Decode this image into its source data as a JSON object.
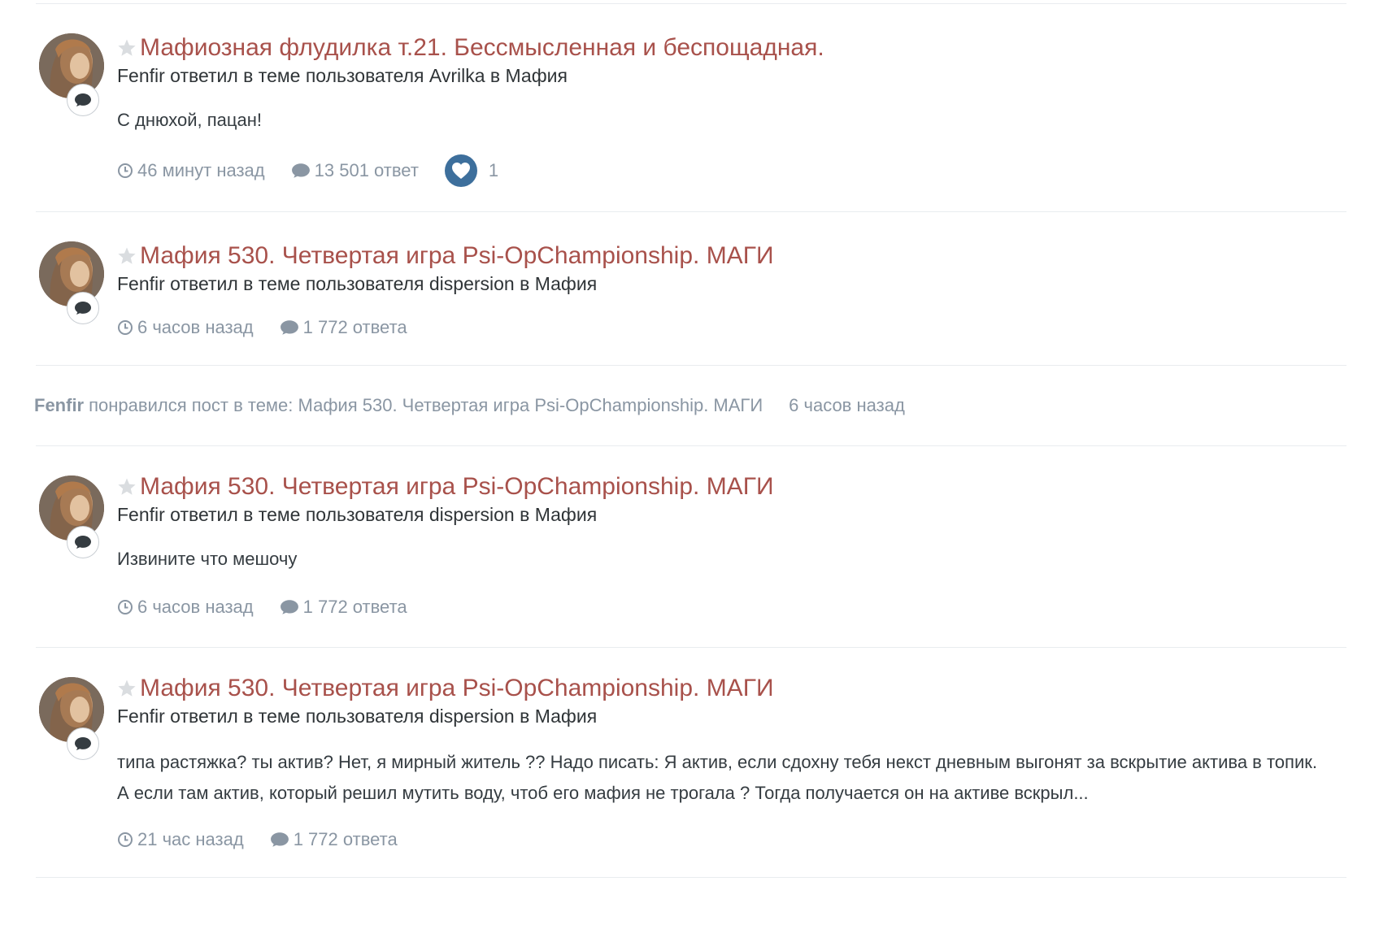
{
  "items": [
    {
      "title": "Мафиозная флудилка т.21. Бессмысленная и беспощадная.",
      "subtitle": "Fenfir ответил в теме пользователя Avrilka в Мафия",
      "snippet": "С днюхой, пацан!",
      "time": "46 минут назад",
      "replies": "13 501 ответ",
      "reaction_count": "1"
    },
    {
      "title": "Мафия 530. Четвертая игра Psi-OpChampionship. МАГИ",
      "subtitle": "Fenfir ответил в теме пользователя dispersion в Мафия",
      "time": "6 часов назад",
      "replies": "1 772 ответа"
    },
    {
      "title": "Мафия 530. Четвертая игра Psi-OpChampionship. МАГИ",
      "subtitle": "Fenfir ответил в теме пользователя dispersion в Мафия",
      "snippet": "Извините что мешочу",
      "time": "6 часов назад",
      "replies": "1 772 ответа"
    },
    {
      "title": "Мафия 530. Четвертая игра Psi-OpChampionship. МАГИ",
      "subtitle": "Fenfir ответил в теме пользователя dispersion в Мафия",
      "snippet": "типа растяжка? ты актив? Нет, я мирный житель ?? Надо писать: Я актив, если сдохну тебя некст дневным выгонят за вскрытие актива в топик. А если там актив, который решил мутить воду, чтоб его мафия не трогала ? Тогда получается он на активе вскрыл...",
      "time": "21 час назад",
      "replies": "1 772 ответа"
    }
  ],
  "like_event": {
    "user": "Fenfir",
    "text": "понравился пост в теме: Мафия 530. Четвертая игра Psi-OpChampionship. МАГИ",
    "time": "6 часов назад"
  },
  "icons": {
    "star": "star-icon",
    "comment_badge": "comment-icon",
    "clock": "clock-icon",
    "replies": "comment-icon",
    "reaction": "heart-icon"
  },
  "colors": {
    "title": "#a8514b",
    "meta": "#8a96a3",
    "reaction_bg": "#3d6f9c"
  }
}
